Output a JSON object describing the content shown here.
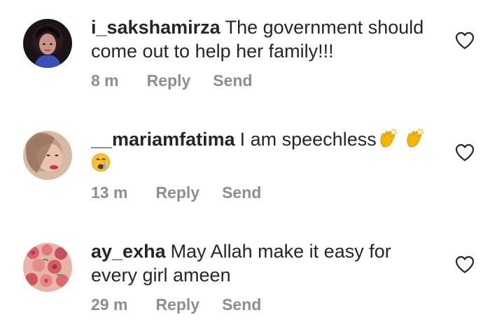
{
  "comments": [
    {
      "username": "i_sakshamirza",
      "text": "The government should come out to help her family!!!",
      "time": "8 m",
      "reply_label": "Reply",
      "send_label": "Send",
      "avatar_icon": "profile-photo-dark",
      "like_icon": "heart-outline-icon"
    },
    {
      "username": "__mariamfatima",
      "text": "I am speechless",
      "emojis": [
        "clapping-hands-emoji",
        "clapping-hands-emoji",
        "crying-face-emoji"
      ],
      "time": "13 m",
      "reply_label": "Reply",
      "send_label": "Send",
      "avatar_icon": "profile-photo-light",
      "like_icon": "heart-outline-icon"
    },
    {
      "username": "ay_exha",
      "text": "May Allah make it easy for every girl ameen",
      "time": "29 m",
      "reply_label": "Reply",
      "send_label": "Send",
      "avatar_icon": "profile-photo-roses",
      "like_icon": "heart-outline-icon"
    }
  ],
  "colors": {
    "text": "#262626",
    "meta": "#8e8e8e",
    "background": "#ffffff"
  }
}
